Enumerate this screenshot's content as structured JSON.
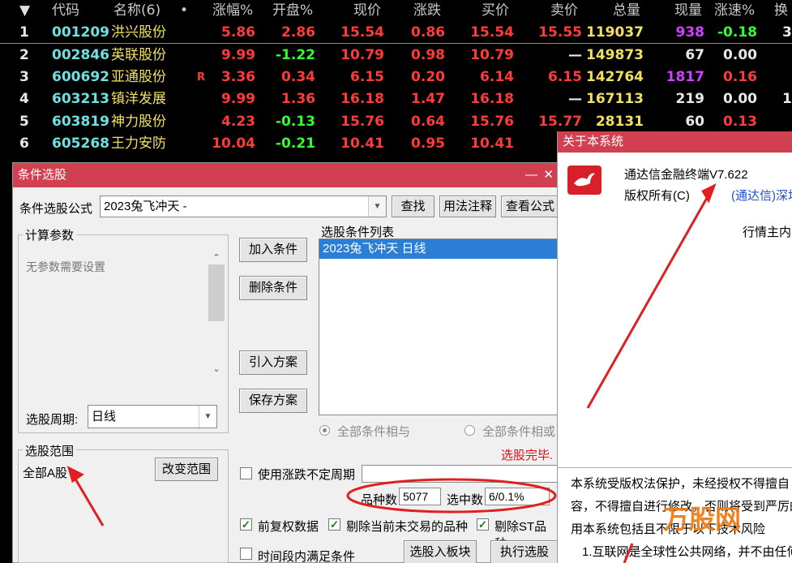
{
  "table": {
    "sort_icon": "triangle-down",
    "headers": [
      "代码",
      "名称(6)",
      "•",
      "涨幅%",
      "开盘%",
      "现价",
      "涨跌",
      "买价",
      "卖价",
      "总量",
      "现量",
      "涨速%",
      "换"
    ],
    "rows": [
      {
        "idx": "1",
        "code": "001209",
        "name": "洪兴股份",
        "flag": "",
        "zf": "5.86",
        "kp": "2.86",
        "xj": "15.54",
        "zd": "0.86",
        "mj": "15.54",
        "maij": "15.55",
        "zl": "119037",
        "xl": "938",
        "zs": "-0.18",
        "hs": "3"
      },
      {
        "idx": "2",
        "code": "002846",
        "name": "英联股份",
        "flag": "",
        "zf": "9.99",
        "kp": "-1.22",
        "xj": "10.79",
        "zd": "0.98",
        "mj": "10.79",
        "maij": "—",
        "zl": "149873",
        "xl": "67",
        "zs": "0.00",
        "hs": ""
      },
      {
        "idx": "3",
        "code": "600692",
        "name": "亚通股份",
        "flag": "R",
        "zf": "3.36",
        "kp": "0.34",
        "xj": "6.15",
        "zd": "0.20",
        "mj": "6.14",
        "maij": "6.15",
        "zl": "142764",
        "xl": "1817",
        "zs": "0.16",
        "hs": ""
      },
      {
        "idx": "4",
        "code": "603213",
        "name": "镇洋发展",
        "flag": "",
        "zf": "9.99",
        "kp": "1.36",
        "xj": "16.18",
        "zd": "1.47",
        "mj": "16.18",
        "maij": "—",
        "zl": "167113",
        "xl": "219",
        "zs": "0.00",
        "hs": "1"
      },
      {
        "idx": "5",
        "code": "603819",
        "name": "神力股份",
        "flag": "",
        "zf": "4.23",
        "kp": "-0.13",
        "xj": "15.76",
        "zd": "0.64",
        "mj": "15.76",
        "maij": "15.77",
        "zl": "28131",
        "xl": "60",
        "zs": "0.13",
        "hs": ""
      },
      {
        "idx": "6",
        "code": "605268",
        "name": "王力安防",
        "flag": "",
        "zf": "10.04",
        "kp": "-0.21",
        "xj": "10.41",
        "zd": "0.95",
        "mj": "10.41",
        "maij": "",
        "zl": "",
        "xl": "",
        "zs": "",
        "hs": ""
      }
    ]
  },
  "dialog": {
    "title": "条件选股",
    "min_glyph": "—",
    "close_glyph": "✕",
    "formula_label": "条件选股公式",
    "formula_value": "2023兔飞冲天 -",
    "btn_find": "查找",
    "btn_usage": "用法注释",
    "btn_view": "查看公式",
    "params_group": "计算参数",
    "params_empty": "无参数需要设置",
    "btn_add": "加入条件",
    "btn_delete": "删除条件",
    "btn_import": "引入方案",
    "btn_save": "保存方案",
    "list_label": "选股条件列表",
    "list_items": [
      "2023兔飞冲天  日线"
    ],
    "period_label": "选股周期:",
    "period_value": "日线",
    "radio_all": "全部条件相与",
    "radio_any": "全部条件相或",
    "status": "选股完毕.",
    "range_group": "选股范围",
    "range_value": "全部A股",
    "btn_change_range": "改变范围",
    "chk_uncertain": "使用涨跌不定周期",
    "count_label": "品种数",
    "count_value": "5077",
    "selected_label": "选中数",
    "selected_value": "6/0.1%",
    "chk_adjust": "前复权数据",
    "chk_exclude_untraded": "剔除当前未交易的品种",
    "chk_exclude_st": "剔除ST品种",
    "chk_time_window": "时间段内满足条件",
    "btn_to_block": "选股入板块",
    "btn_execute": "执行选股"
  },
  "about": {
    "title": "关于本系统",
    "product": "通达信金融终端V7.622",
    "copyright": "版权所有(C)",
    "company": "(通达信)深圳",
    "quote_line": "行情主内",
    "notice_1": "本系统受版权法保护，未经授权不得擅自",
    "notice_2": "容，不得擅自进行修改，否则将受到严厉的",
    "notice_3": "用本系统包括且不限于以下技术风险",
    "notice_4": "1.互联网是全球性公共网络，并不由任何",
    "watermark": "万股网"
  },
  "colors": {
    "rise": "#ff3a3a",
    "fall": "#30ff30",
    "code": "#6fe0e0",
    "name": "#f0e060",
    "title_bar": "#d04050",
    "annotation": "#e02020"
  }
}
